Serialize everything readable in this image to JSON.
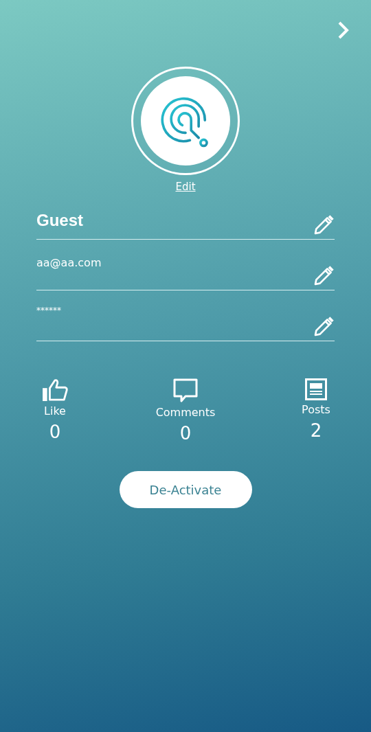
{
  "avatar": {
    "edit_label": "Edit"
  },
  "fields": [
    {
      "kind": "name",
      "value": "Guest"
    },
    {
      "kind": "email",
      "value": "aa@aa.com"
    },
    {
      "kind": "password",
      "value": "******"
    }
  ],
  "stats": [
    {
      "kind": "like",
      "label": "Like",
      "value": "0"
    },
    {
      "kind": "comments",
      "label": "Comments",
      "value": "0"
    },
    {
      "kind": "posts",
      "label": "Posts",
      "value": "2"
    }
  ],
  "button": {
    "label": "De-Activate"
  }
}
